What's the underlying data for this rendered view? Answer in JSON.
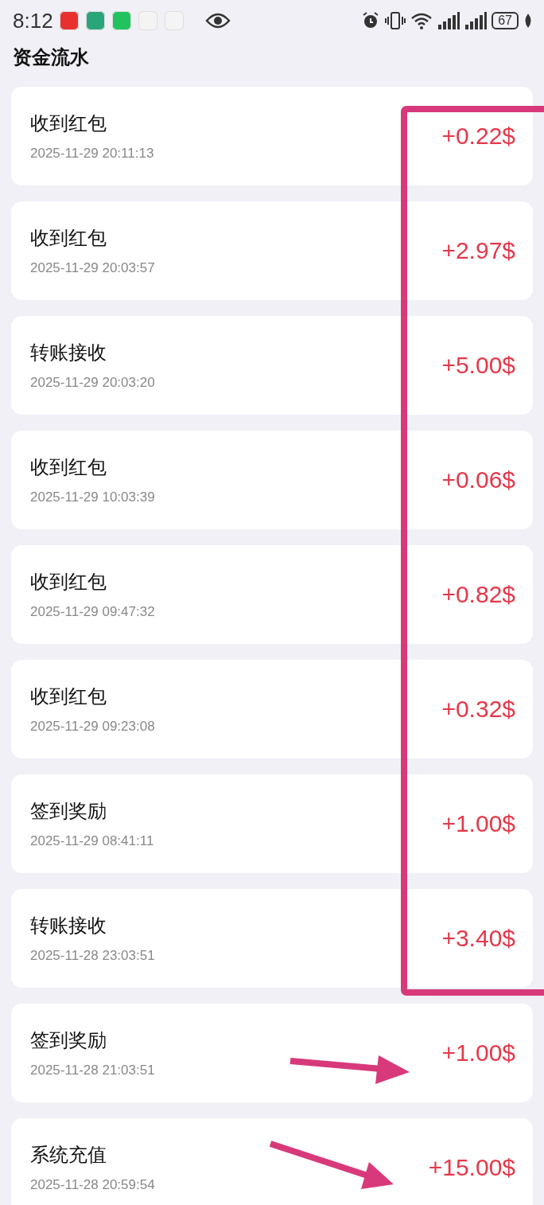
{
  "status_bar": {
    "time": "8:12",
    "battery": "67"
  },
  "title": "资金流水",
  "records": [
    {
      "title": "收到红包",
      "time": "2025-11-29 20:11:13",
      "amount": "+0.22$"
    },
    {
      "title": "收到红包",
      "time": "2025-11-29 20:03:57",
      "amount": "+2.97$"
    },
    {
      "title": "转账接收",
      "time": "2025-11-29 20:03:20",
      "amount": "+5.00$"
    },
    {
      "title": "收到红包",
      "time": "2025-11-29 10:03:39",
      "amount": "+0.06$"
    },
    {
      "title": "收到红包",
      "time": "2025-11-29 09:47:32",
      "amount": "+0.82$"
    },
    {
      "title": "收到红包",
      "time": "2025-11-29 09:23:08",
      "amount": "+0.32$"
    },
    {
      "title": "签到奖励",
      "time": "2025-11-29 08:41:11",
      "amount": "+1.00$"
    },
    {
      "title": "转账接收",
      "time": "2025-11-28 23:03:51",
      "amount": "+3.40$"
    },
    {
      "title": "签到奖励",
      "time": "2025-11-28 21:03:51",
      "amount": "+1.00$"
    },
    {
      "title": "系统充值",
      "time": "2025-11-28 20:59:54",
      "amount": "+15.00$"
    }
  ]
}
